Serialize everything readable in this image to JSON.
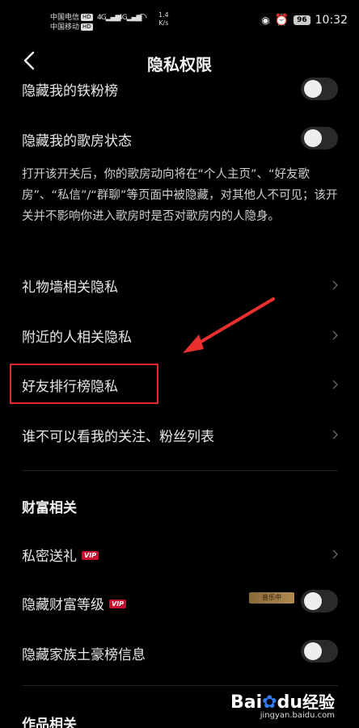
{
  "status": {
    "carrier1": "中国电信",
    "carrier2": "中国移动",
    "hd": "HD",
    "signal1": "4G",
    "signal2": "4G",
    "speed_value": "1.4",
    "speed_unit": "K/s",
    "battery": "96",
    "time": "10:32"
  },
  "nav": {
    "title": "隐私权限"
  },
  "rows": {
    "hide_fans": "隐藏我的铁粉榜",
    "hide_room": "隐藏我的歌房状态",
    "room_desc": "打开该开关后，你的歌房动向将在“个人主页”、“好友歌房”、“私信”/“群聊”等页面中被隐藏，对其他人不可见；该开关并不影响你进入歌房时是否对歌房内的人隐身。",
    "gift_wall": "礼物墙相关隐私",
    "nearby": "附近的人相关隐私",
    "friend_rank": "好友排行榜隐私",
    "follow_list": "谁不可以看我的关注、粉丝列表"
  },
  "wealth": {
    "title": "财富相关",
    "private_gift": "私密送礼",
    "hide_level": "隐藏财富等级",
    "hide_family": "隐藏家族土豪榜信息",
    "vip": "VIP",
    "level_badge": "音乐中"
  },
  "works": {
    "title": "作品相关"
  },
  "watermark": {
    "brand_bai": "Bai",
    "brand_du": "du",
    "brand_jy": "经验",
    "url": "jingyan.baidu.com"
  }
}
